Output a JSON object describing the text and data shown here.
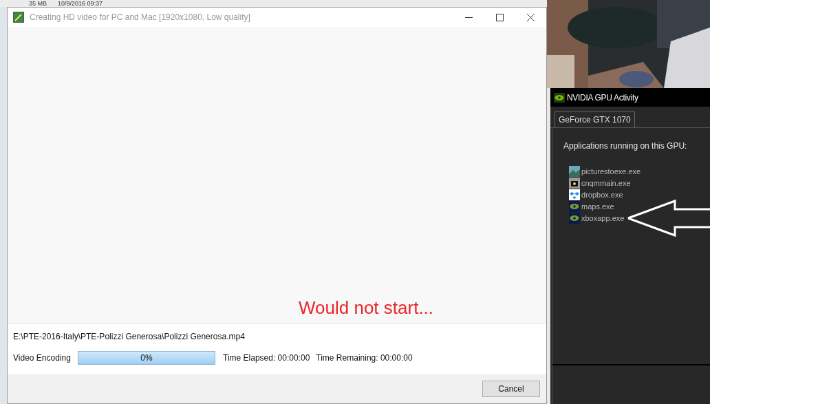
{
  "background_file": {
    "size": "35 MB",
    "date": "10/9/2016 09:37"
  },
  "dialog": {
    "title": "Creating HD video for PC and Mac [1920x1080, Low quality]",
    "output_path": "E:\\PTE-2016-Italy\\PTE-Polizzi Generosa\\Polizzi Generosa.mp4",
    "task_label": "Video Encoding",
    "progress": {
      "level": 0,
      "text": "0%"
    },
    "time_elapsed": "Time Elapsed: 00:00:00",
    "time_remaining": "Time Remaining: 00:00:00",
    "buttons": [
      "Cancel"
    ]
  },
  "annotation": "Would not start...",
  "gpu_panel": {
    "title": "NVIDIA GPU Activity",
    "tabs": [
      {
        "label": "GeForce GTX 1070",
        "selected": true
      }
    ],
    "heading": "Applications running on this GPU:",
    "apps": [
      {
        "name": "picturestoexe.exe",
        "kind": "pictures"
      },
      {
        "name": "cnqmmain.exe",
        "kind": "camera"
      },
      {
        "name": "dropbox.exe",
        "kind": "dropbox"
      },
      {
        "name": "maps.exe",
        "kind": "nvidia"
      },
      {
        "name": "xboxapp.exe",
        "kind": "nvidia"
      }
    ]
  }
}
